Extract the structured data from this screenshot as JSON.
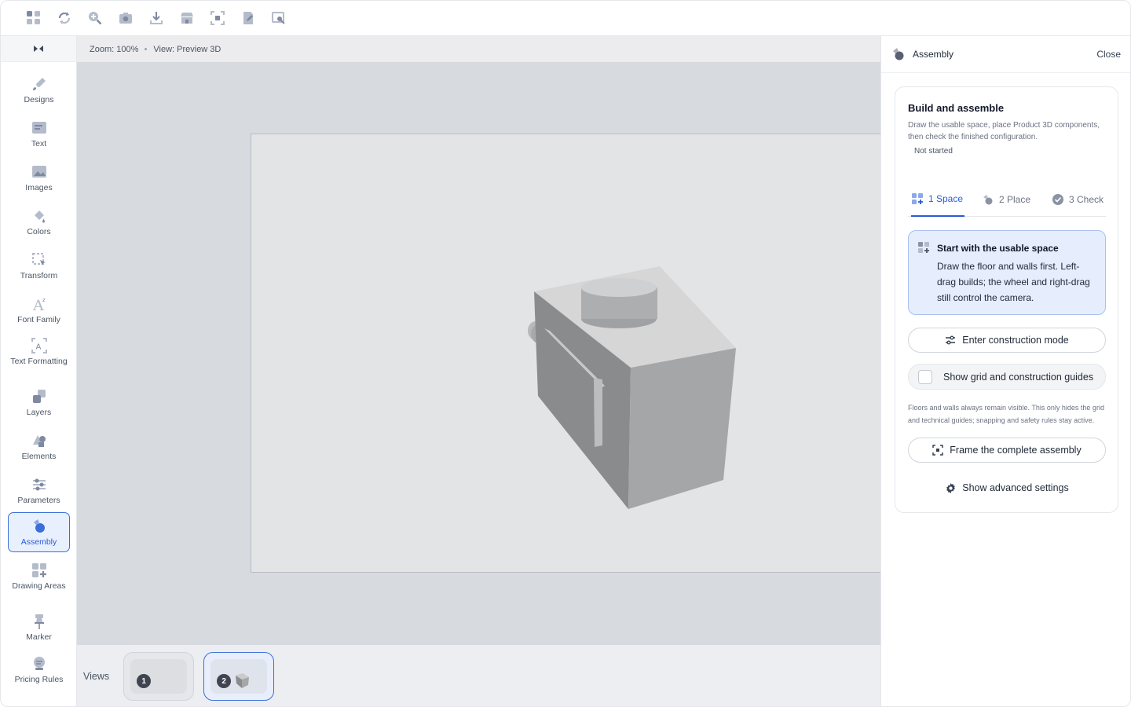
{
  "toolbar": {
    "icons": [
      "apps-icon",
      "rotate-icon",
      "zoom-in-icon",
      "camera-icon",
      "download-icon",
      "store-icon",
      "fit-screen-icon",
      "edit-document-icon",
      "zoom-area-icon"
    ]
  },
  "sidebar": {
    "items": [
      {
        "label": "Designs",
        "icon": "brush-icon"
      },
      {
        "label": "Text",
        "icon": "text-icon"
      },
      {
        "label": "Images",
        "icon": "image-icon"
      },
      {
        "label": "Colors",
        "icon": "paint-bucket-icon"
      },
      {
        "label": "Transform",
        "icon": "transform-icon"
      },
      {
        "label": "Font Family",
        "icon": "font-family-icon"
      },
      {
        "label": "Text Formatting",
        "icon": "text-formatting-icon"
      },
      {
        "label": "Layers",
        "icon": "layers-icon"
      },
      {
        "label": "Elements",
        "icon": "elements-icon"
      },
      {
        "label": "Parameters",
        "icon": "parameters-icon"
      },
      {
        "label": "Assembly",
        "icon": "assembly-icon",
        "active": true
      },
      {
        "label": "Drawing Areas",
        "icon": "drawing-areas-icon"
      },
      {
        "label": "Marker",
        "icon": "marker-icon"
      },
      {
        "label": "Pricing Rules",
        "icon": "pricing-rules-icon"
      }
    ]
  },
  "canvas": {
    "zoom": "Zoom: 100%",
    "view": "View: Preview 3D"
  },
  "views": {
    "label": "Views",
    "items": [
      {
        "number": "1",
        "active": false
      },
      {
        "number": "2",
        "active": true
      }
    ]
  },
  "panel": {
    "title": "Assembly",
    "close_label": "Close",
    "heading": "Build and assemble",
    "description": "Draw the usable space, place Product 3D components, then check the finished configuration.",
    "status": "Not started",
    "steps": [
      {
        "label": "1 Space",
        "active": true
      },
      {
        "label": "2 Place",
        "active": false
      },
      {
        "label": "3 Check",
        "active": false
      }
    ],
    "hint_title": "Start with the usable space",
    "hint_body": "Draw the floor and walls first. Left-drag builds; the wheel and right-drag still control the camera.",
    "construction_button": "Enter construction mode",
    "grid_toggle": "Show grid and construction guides",
    "note": "Floors and walls always remain visible. This only hides the grid and technical guides; snapping and safety rules stay active.",
    "frame_button": "Frame the complete assembly",
    "advanced_button": "Show advanced settings"
  },
  "colors": {
    "accent": "#2a5bd7",
    "hint_bg": "#e6edfc"
  }
}
